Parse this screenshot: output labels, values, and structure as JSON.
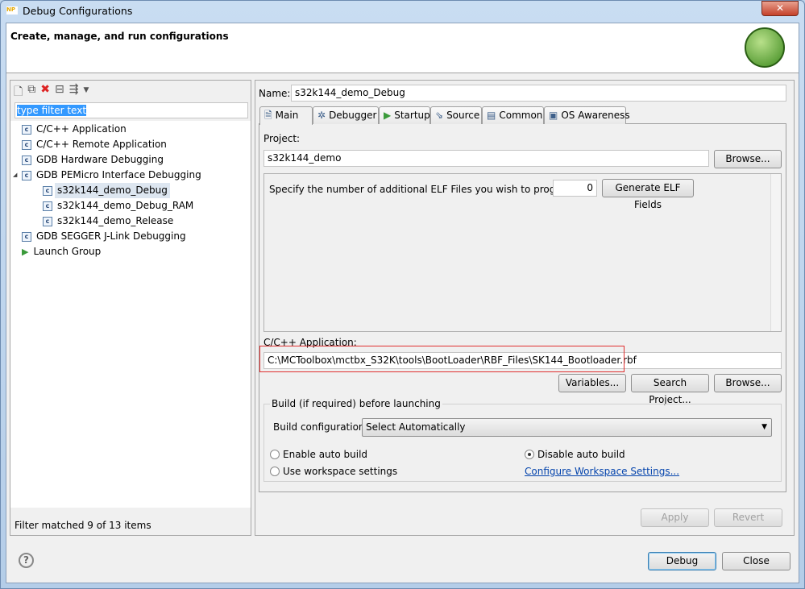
{
  "window": {
    "title": "Debug Configurations",
    "close": "✕"
  },
  "banner": {
    "heading": "Create, manage, and run configurations"
  },
  "left": {
    "filter_value": "type filter text",
    "items": [
      {
        "label": "C/C++ Application",
        "level": 0
      },
      {
        "label": "C/C++ Remote Application",
        "level": 0
      },
      {
        "label": "GDB Hardware Debugging",
        "level": 0
      },
      {
        "label": "GDB PEMicro Interface Debugging",
        "level": 0,
        "expanded": true
      },
      {
        "label": "s32k144_demo_Debug",
        "level": 1,
        "selected": true
      },
      {
        "label": "s32k144_demo_Debug_RAM",
        "level": 1
      },
      {
        "label": "s32k144_demo_Release",
        "level": 1
      },
      {
        "label": "GDB SEGGER J-Link Debugging",
        "level": 0
      },
      {
        "label": "Launch Group",
        "level": 0,
        "icon": "launch-group-icon"
      }
    ],
    "status": "Filter matched 9 of 13 items"
  },
  "main": {
    "name_label": "Name:",
    "name_value": "s32k144_demo_Debug",
    "tabs": [
      {
        "label": "Main",
        "icon": "document-icon"
      },
      {
        "label": "Debugger",
        "icon": "bug-icon"
      },
      {
        "label": "Startup",
        "icon": "play-icon"
      },
      {
        "label": "Source",
        "icon": "source-icon"
      },
      {
        "label": "Common",
        "icon": "table-icon"
      },
      {
        "label": "OS Awareness",
        "icon": "os-icon"
      }
    ],
    "project_label": "Project:",
    "project_value": "s32k144_demo",
    "browse": "Browse...",
    "elf_label": "Specify the number of additional ELF Files you wish to program:",
    "elf_value": "0",
    "generate": "Generate ELF Fields",
    "app_label": "C/C++ Application:",
    "app_value": "C:\\MCToolbox\\mctbx_S32K\\tools\\BootLoader\\RBF_Files\\SK144_Bootloader.rbf",
    "variables": "Variables...",
    "search_project": "Search Project...",
    "browse2": "Browse...",
    "build_group": "Build (if required) before launching",
    "build_config_label": "Build configuration:",
    "build_config_value": "Select Automatically",
    "enable_auto": "Enable auto build",
    "disable_auto": "Disable auto build",
    "use_workspace": "Use workspace settings",
    "configure_link": "Configure Workspace Settings...",
    "apply": "Apply",
    "revert": "Revert"
  },
  "footer": {
    "debug": "Debug",
    "close": "Close",
    "help": "?"
  },
  "colors": {
    "highlight_box": "#e03030",
    "link": "#0645ad",
    "selection": "#3399ff"
  }
}
